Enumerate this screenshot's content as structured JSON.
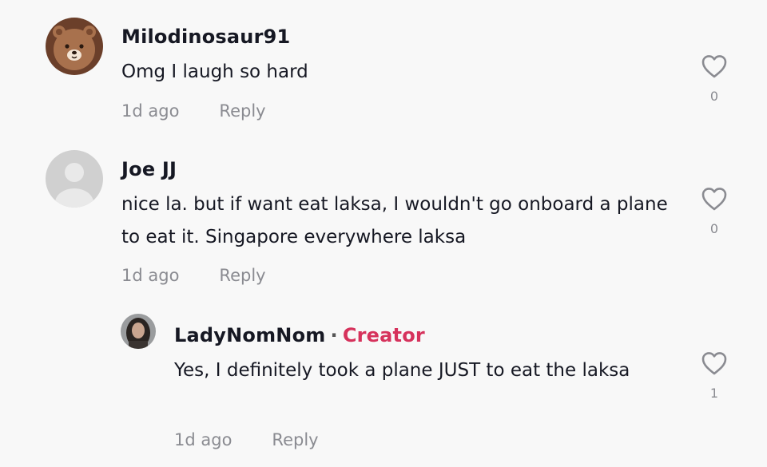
{
  "comments": [
    {
      "username": "Milodinosaur91",
      "text": "Omg I laugh so hard",
      "time": "1d ago",
      "reply_label": "Reply",
      "likes": "0",
      "avatar_icon": "bear-avatar"
    },
    {
      "username": "Joe JJ",
      "text": "nice la. but if want eat laksa, I wouldn't go onboard a plane to eat it. Singapore everywhere laksa",
      "time": "1d ago",
      "reply_label": "Reply",
      "likes": "0",
      "avatar_icon": "default-avatar"
    }
  ],
  "reply": {
    "username": "LadyNomNom",
    "separator": "·",
    "badge": "Creator",
    "text": "Yes, I definitely took a plane JUST to eat the laksa",
    "time": "1d ago",
    "reply_label": "Reply",
    "likes": "1",
    "avatar_icon": "user-photo-avatar"
  },
  "colors": {
    "background": "#f8f8f8",
    "creator": "#d6325c",
    "muted": "#8a8b91"
  }
}
